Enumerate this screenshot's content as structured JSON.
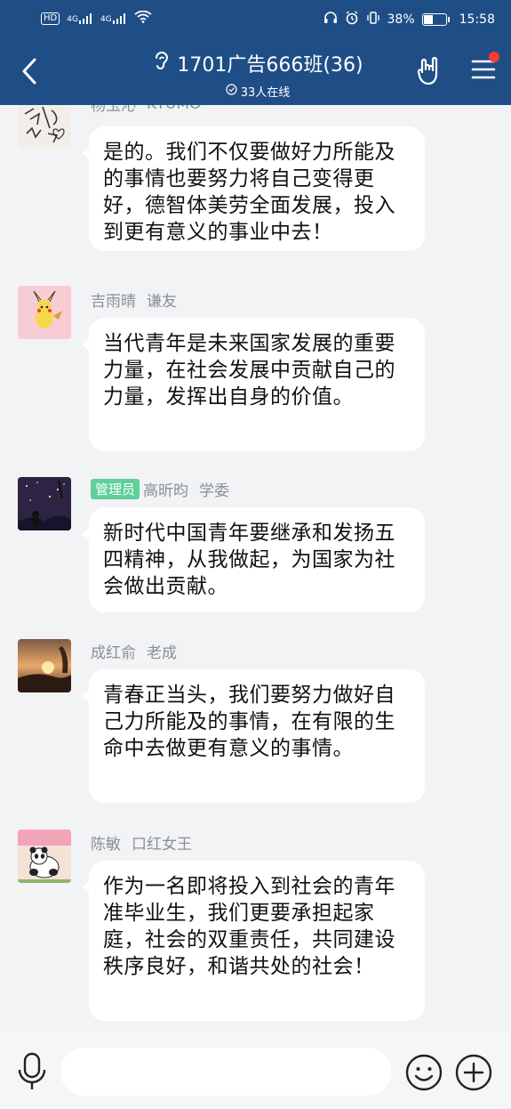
{
  "status_bar": {
    "hd_label": "HD",
    "network1": "4G",
    "network2": "4G",
    "battery_percent": "38%",
    "time": "15:58"
  },
  "header": {
    "title": "1701广告666班(36)",
    "online": "33人在线",
    "icons": [
      "back-icon",
      "ear-icon",
      "hand-icon",
      "menu-icon"
    ]
  },
  "messages": [
    {
      "name": "杨玉沁",
      "nickname": "KYUMO",
      "badge": "",
      "text": "是的。我们不仅要做好力所能及的事情也要努力将自己变得更好，德智体美劳全面发展，投入到更有意义的事业中去！"
    },
    {
      "name": "吉雨晴",
      "nickname": "谦友",
      "badge": "",
      "text": "当代青年是未来国家发展的重要力量，在社会发展中贡献自己的力量，发挥出自身的价值。"
    },
    {
      "name": "高昕昀",
      "nickname": "学委",
      "badge": "管理员",
      "text": "新时代中国青年要继承和发扬五四精神，从我做起，为国家为社会做出贡献。"
    },
    {
      "name": "成红俞",
      "nickname": "老成",
      "badge": "",
      "text": "青春正当头，我们要努力做好自己力所能及的事情，在有限的生命中去做更有意义的事情。"
    },
    {
      "name": "陈敏",
      "nickname": "口红女王",
      "badge": "",
      "text": "作为一名即将投入到社会的青年准毕业生，我们更要承担起家庭，社会的双重责任，共同建设秩序良好，和谐共处的社会！"
    }
  ],
  "input": {
    "value": "",
    "placeholder": ""
  },
  "colors": {
    "header": "#1f4e86",
    "badge": "#5fcf9c",
    "background": "#f2f3f5"
  }
}
